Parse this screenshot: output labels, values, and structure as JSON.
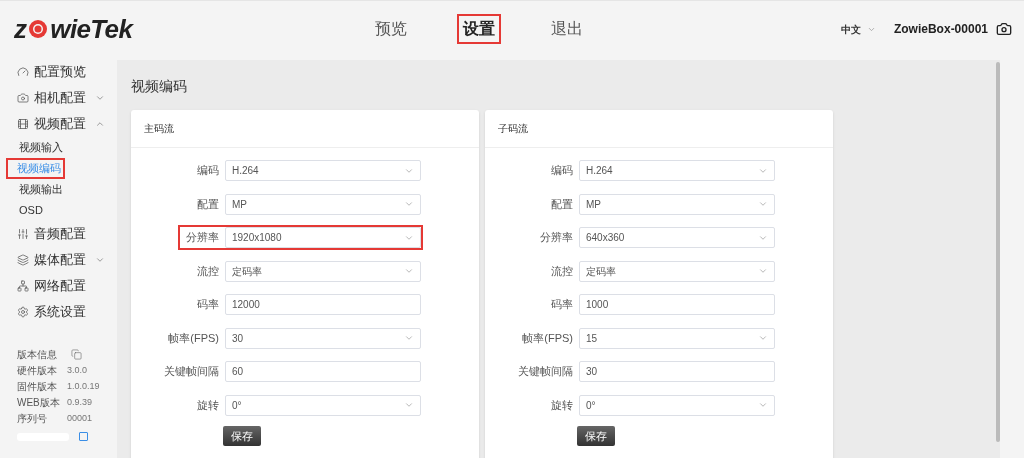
{
  "logo": {
    "before": "z",
    "after": "wieTek"
  },
  "nav": [
    {
      "label": "预览",
      "selected": false,
      "highlighted": false
    },
    {
      "label": "设置",
      "selected": true,
      "highlighted": true
    },
    {
      "label": "退出",
      "selected": false,
      "highlighted": false
    }
  ],
  "language": "中文",
  "device_name": "ZowieBox-00001",
  "sidebar": {
    "items": [
      {
        "label": "配置预览"
      },
      {
        "label": "相机配置",
        "expanded": false
      },
      {
        "label": "视频配置",
        "expanded": true,
        "children": [
          {
            "label": "视频输入",
            "selected": false,
            "highlighted": false
          },
          {
            "label": "视频编码",
            "selected": true,
            "highlighted": true
          },
          {
            "label": "视频输出",
            "selected": false,
            "highlighted": false
          },
          {
            "label": "OSD",
            "selected": false,
            "highlighted": false
          }
        ]
      },
      {
        "label": "音频配置"
      },
      {
        "label": "媒体配置",
        "expanded": false
      },
      {
        "label": "网络配置"
      },
      {
        "label": "系统设置"
      }
    ],
    "version_title": "版本信息",
    "versions": [
      {
        "label": "硬件版本",
        "value": "3.0.0"
      },
      {
        "label": "固件版本",
        "value": "1.0.0.19"
      },
      {
        "label": "WEB版本",
        "value": "0.9.39"
      },
      {
        "label": "序列号",
        "value": "00001"
      }
    ]
  },
  "page_title": "视频编码",
  "panels": [
    {
      "title": "主码流",
      "save": "保存",
      "fields": [
        {
          "label": "编码",
          "kind": "select",
          "value": "H.264",
          "highlighted": false
        },
        {
          "label": "配置",
          "kind": "select",
          "value": "MP",
          "highlighted": false
        },
        {
          "label": "分辨率",
          "kind": "select",
          "value": "1920x1080",
          "highlighted": true
        },
        {
          "label": "流控",
          "kind": "select",
          "value": "定码率",
          "highlighted": false
        },
        {
          "label": "码率",
          "kind": "input",
          "value": "12000",
          "highlighted": false
        },
        {
          "label": "帧率(FPS)",
          "kind": "select",
          "value": "30",
          "highlighted": false
        },
        {
          "label": "关键帧间隔",
          "kind": "input",
          "value": "60",
          "highlighted": false
        },
        {
          "label": "旋转",
          "kind": "select",
          "value": "0°",
          "highlighted": false
        }
      ]
    },
    {
      "title": "子码流",
      "save": "保存",
      "fields": [
        {
          "label": "编码",
          "kind": "select",
          "value": "H.264",
          "highlighted": false
        },
        {
          "label": "配置",
          "kind": "select",
          "value": "MP",
          "highlighted": false
        },
        {
          "label": "分辨率",
          "kind": "select",
          "value": "640x360",
          "highlighted": false
        },
        {
          "label": "流控",
          "kind": "select",
          "value": "定码率",
          "highlighted": false
        },
        {
          "label": "码率",
          "kind": "input",
          "value": "1000",
          "highlighted": false
        },
        {
          "label": "帧率(FPS)",
          "kind": "select",
          "value": "15",
          "highlighted": false
        },
        {
          "label": "关键帧间隔",
          "kind": "input",
          "value": "30",
          "highlighted": false
        },
        {
          "label": "旋转",
          "kind": "select",
          "value": "0°",
          "highlighted": false
        }
      ]
    }
  ]
}
